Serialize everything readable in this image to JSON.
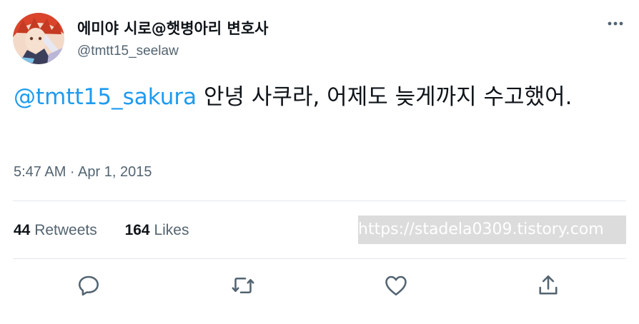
{
  "tweet": {
    "author": {
      "display_name": "에미야 시로@햇병아리 변호사",
      "handle": "@tmtt15_seelaw",
      "avatar_icon": "avatar-image"
    },
    "more_icon": "more-horizontal-icon",
    "text": {
      "mention": "@tmtt15_sakura",
      "body": " 안녕 사쿠라, 어제도 늦게까지 수고했어."
    },
    "timestamp": "5:47 AM · Apr 1, 2015",
    "stats": {
      "retweets_count": "44",
      "retweets_label": " Retweets",
      "likes_count": "164",
      "likes_label": " Likes"
    },
    "watermark": "https://stadela0309.tistory.com",
    "actions": [
      {
        "name": "reply",
        "icon": "reply-icon"
      },
      {
        "name": "retweet",
        "icon": "retweet-icon"
      },
      {
        "name": "like",
        "icon": "heart-icon"
      },
      {
        "name": "share",
        "icon": "share-icon"
      }
    ]
  },
  "colors": {
    "accent": "#1d9bf0",
    "text": "#0f1419",
    "secondary": "#536471",
    "divider": "#e1e6ea"
  }
}
